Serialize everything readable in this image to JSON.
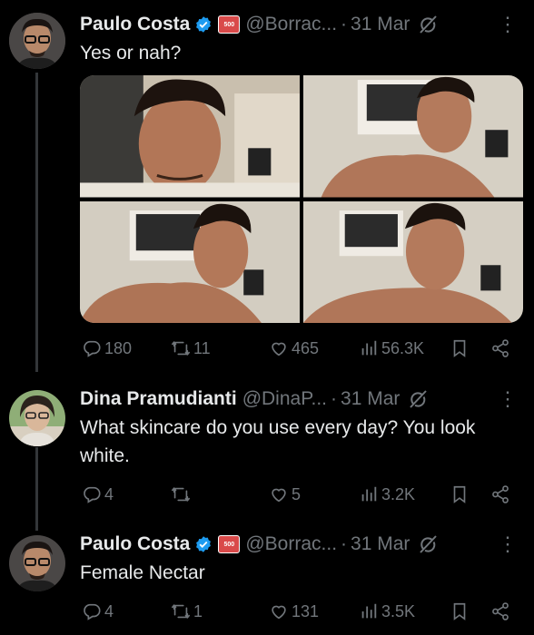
{
  "tweets": [
    {
      "name": "Paulo Costa",
      "handle": "@Borrac...",
      "date": "31 Mar",
      "text": "Yes or nah?",
      "stats": {
        "replies": "180",
        "reposts": "11",
        "likes": "465",
        "views": "56.3K"
      }
    },
    {
      "name": "Dina Pramudianti",
      "handle": "@DinaP...",
      "date": "31 Mar",
      "text": "What skincare do you use every day? You look white.",
      "stats": {
        "replies": "4",
        "reposts": "",
        "likes": "5",
        "views": "3.2K"
      }
    },
    {
      "name": "Paulo Costa",
      "handle": "@Borrac...",
      "date": "31 Mar",
      "text": "Female Nectar",
      "stats": {
        "replies": "4",
        "reposts": "1",
        "likes": "131",
        "views": "3.5K"
      }
    }
  ],
  "separator": "·",
  "badge_text": "500",
  "colors": {
    "background": "#000000",
    "text": "#e7e9ea",
    "muted": "#71767b",
    "verified": "#1d9bf0"
  },
  "icons": [
    "verified-icon",
    "affiliate-badge-icon",
    "grok-icon",
    "more-icon",
    "reply-icon",
    "repost-icon",
    "like-icon",
    "views-icon",
    "bookmark-icon",
    "share-icon"
  ]
}
